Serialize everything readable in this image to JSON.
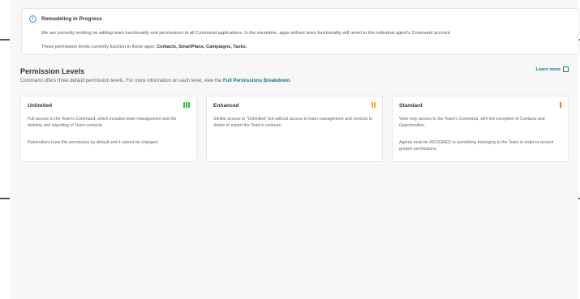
{
  "notice": {
    "icon": "info-icon",
    "title": "Remodeling in Progress",
    "body": "We are currently working on adding team functionality and permissions to all Command applications. In the meantime, apps without team functionality will revert to the individual agent's Command account.",
    "apps_prefix": "These permission levels currently function in these apps:",
    "apps_list": "Contacts, SmartPlans, Campaigns, Tasks."
  },
  "section": {
    "title": "Permission Levels",
    "subtitle_prefix": "Command offers three default permission levels. For more information on each level, view the",
    "subtitle_link": "Full Permissions Breakdown.",
    "learn_more": "Learn more"
  },
  "cards": [
    {
      "title": "Unlimited",
      "level_color": "#3bb54a",
      "level_bars": 3,
      "text1": "Full access to the Team's Command, which includes team management and the deleting and exporting of Team contacts.",
      "text2": "Rainmakers have this permission by default and it cannot be changed."
    },
    {
      "title": "Enhanced",
      "level_color": "#f0a93a",
      "level_bars": 2,
      "text1": "Similar access to \"Unlimited\" but without access to team management and controls to delete or export the Team's contacts.",
      "text2": ""
    },
    {
      "title": "Standard",
      "level_color": "#e8743b",
      "level_bars": 1,
      "text1": "View-only access to the Team's Command, with the exception of Contacts and Opportunities.",
      "text2": "Agents must be ASSIGNED to something belonging to the Team in order to receive greater permissions."
    }
  ]
}
